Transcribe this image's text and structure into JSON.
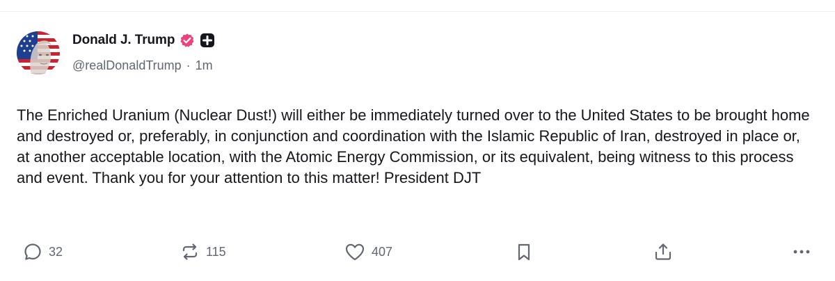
{
  "author": {
    "display_name": "Donald J. Trump",
    "handle": "@realDonaldTrump",
    "separator": "·",
    "time_ago": "1m",
    "verified_badge_icon": "verified-badge-icon",
    "plus_badge_icon": "plus-badge-icon",
    "colors": {
      "verified": "#e8457a",
      "plus_badge": "#16161d"
    }
  },
  "post": {
    "text": "The Enriched Uranium (Nuclear Dust!) will either be immediately turned over to the United States to be brought home and destroyed or, preferably, in conjunction and coordination with the Islamic Republic of Iran, destroyed in place or, at another acceptable location, with the Atomic Energy Commission, or its equivalent, being witness to this process and event. Thank you for your attention to this matter! President DJT"
  },
  "actions": {
    "reply": {
      "icon": "reply-icon",
      "count": "32"
    },
    "retruth": {
      "icon": "retruth-icon",
      "count": "115"
    },
    "like": {
      "icon": "heart-icon",
      "count": "407"
    },
    "bookmark": {
      "icon": "bookmark-icon"
    },
    "share": {
      "icon": "share-icon"
    },
    "more": {
      "icon": "more-icon"
    }
  },
  "colors": {
    "text": "#16161d",
    "muted": "#606770",
    "divider": "#eceef1"
  }
}
